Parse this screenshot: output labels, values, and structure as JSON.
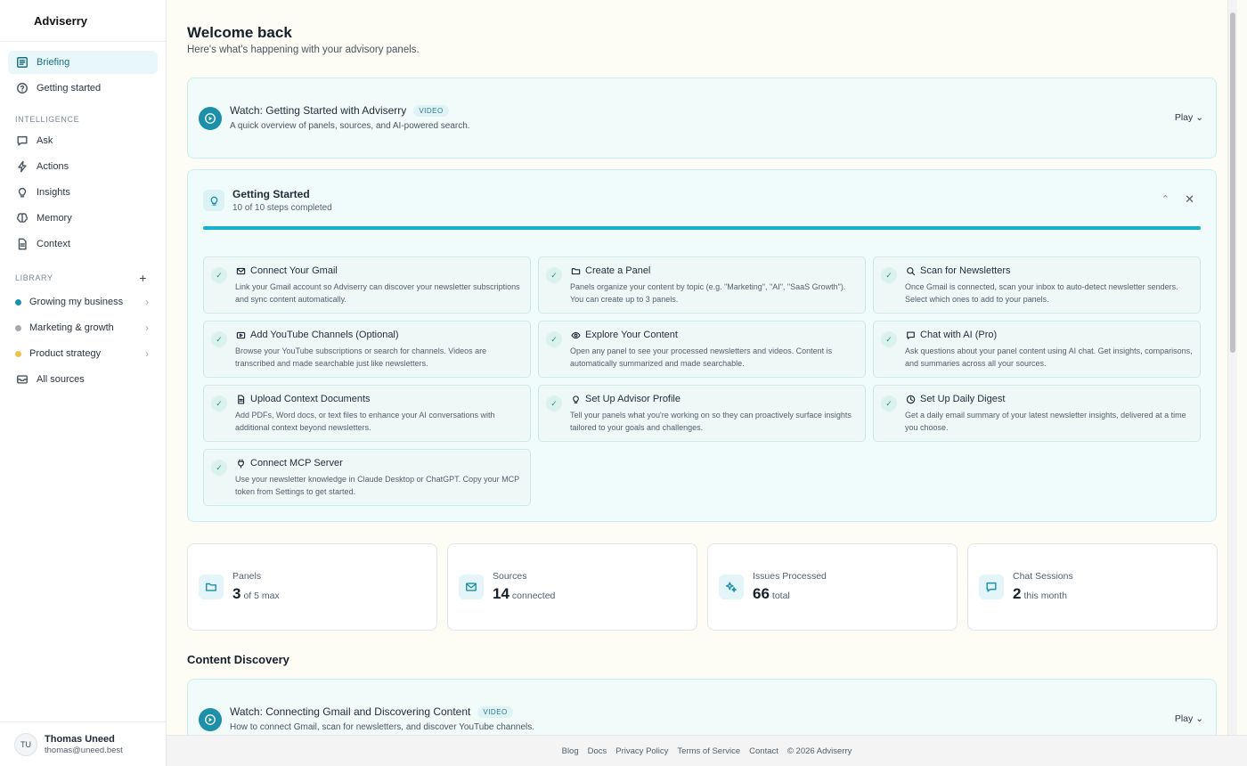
{
  "brand": "Adviserry",
  "nav": {
    "briefing": "Briefing",
    "getting_started": "Getting started"
  },
  "intelligence": {
    "label": "INTELLIGENCE",
    "items": [
      "Ask",
      "Actions",
      "Insights",
      "Memory",
      "Context"
    ]
  },
  "library": {
    "label": "LIBRARY",
    "panels": [
      {
        "name": "Growing my business",
        "color": "#1a8fb0"
      },
      {
        "name": "Marketing & growth",
        "color": "#a6aab0"
      },
      {
        "name": "Product strategy",
        "color": "#f0c24a"
      }
    ],
    "all_sources": "All sources"
  },
  "user": {
    "initials": "TU",
    "name": "Thomas Uneed",
    "email": "thomas@uneed.best"
  },
  "header": {
    "title": "Welcome back",
    "subtitle": "Here's what's happening with your advisory panels."
  },
  "video1": {
    "title": "Watch: Getting Started with Adviserry",
    "badge": "VIDEO",
    "description": "A quick overview of panels, sources, and AI-powered search.",
    "play": "Play"
  },
  "getting_started": {
    "title": "Getting Started",
    "progress_text": "10 of 10 steps completed",
    "progress": 1.0,
    "steps": [
      {
        "title": "Connect Your Gmail",
        "icon": "mail-icon",
        "desc": "Link your Gmail account so Adviserry can discover your newsletter subscriptions and sync content automatically."
      },
      {
        "title": "Create a Panel",
        "icon": "folder-icon",
        "desc": "Panels organize your content by topic (e.g. \"Marketing\", \"AI\", \"SaaS Growth\"). You can create up to 3 panels."
      },
      {
        "title": "Scan for Newsletters",
        "icon": "search-icon",
        "desc": "Once Gmail is connected, scan your inbox to auto-detect newsletter senders. Select which ones to add to your panels."
      },
      {
        "title": "Add YouTube Channels (Optional)",
        "icon": "youtube-icon",
        "desc": "Browse your YouTube subscriptions or search for channels. Videos are transcribed and made searchable just like newsletters."
      },
      {
        "title": "Explore Your Content",
        "icon": "eye-icon",
        "desc": "Open any panel to see your processed newsletters and videos. Content is automatically summarized and made searchable."
      },
      {
        "title": "Chat with AI (Pro)",
        "icon": "chat-icon",
        "desc": "Ask questions about your panel content using AI chat. Get insights, comparisons, and summaries across all your sources."
      },
      {
        "title": "Upload Context Documents",
        "icon": "document-icon",
        "desc": "Add PDFs, Word docs, or text files to enhance your AI conversations with additional context beyond newsletters."
      },
      {
        "title": "Set Up Advisor Profile",
        "icon": "lightbulb-icon",
        "desc": "Tell your panels what you're working on so they can proactively surface insights tailored to your goals and challenges."
      },
      {
        "title": "Set Up Daily Digest",
        "icon": "clock-icon",
        "desc": "Get a daily email summary of your latest newsletter insights, delivered at a time you choose."
      },
      {
        "title": "Connect MCP Server",
        "icon": "plug-icon",
        "desc": "Use your newsletter knowledge in Claude Desktop or ChatGPT. Copy your MCP token from Settings to get started."
      }
    ]
  },
  "stats": [
    {
      "label": "Panels",
      "value": "3",
      "unit": "of 5 max",
      "icon": "folder-icon"
    },
    {
      "label": "Sources",
      "value": "14",
      "unit": "connected",
      "icon": "mail-icon"
    },
    {
      "label": "Issues Processed",
      "value": "66",
      "unit": "total",
      "icon": "sparkles-icon"
    },
    {
      "label": "Chat Sessions",
      "value": "2",
      "unit": "this month",
      "icon": "chat-icon"
    }
  ],
  "content_discovery": {
    "title": "Content Discovery",
    "video": {
      "title": "Watch: Connecting Gmail and Discovering Content",
      "badge": "VIDEO",
      "description": "How to connect Gmail, scan for newsletters, and discover YouTube channels.",
      "play": "Play"
    }
  },
  "footer": {
    "links": [
      "Blog",
      "Docs",
      "Privacy Policy",
      "Terms of Service",
      "Contact"
    ],
    "copyright": "© 2026 Adviserry"
  },
  "colors": {
    "accent": "#1d8fa8",
    "progress": "#16b2cc"
  }
}
